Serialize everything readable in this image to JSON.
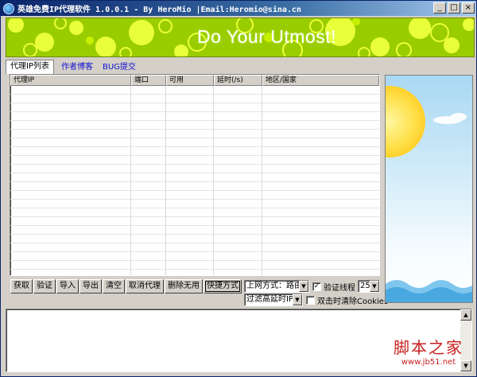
{
  "window": {
    "title": "英雄免费IP代理软件 1.0.0.1 - By HeroMio |Email:Heromio@sina.cn",
    "minimize": "_",
    "maximize": "□",
    "close": "×"
  },
  "banner": {
    "text": "Do Your Utmost!",
    "background_color": "#9acd00",
    "bubble_color": "#e9ff3a"
  },
  "tabs": [
    {
      "label": "代理IP列表",
      "active": true
    },
    {
      "label": "作者博客",
      "active": false
    },
    {
      "label": "BUG提交",
      "active": false
    }
  ],
  "proxy_table": {
    "columns": [
      "代理IP",
      "端口",
      "可用",
      "延时(/s)",
      "地区/国家"
    ],
    "rows": []
  },
  "buttons": {
    "fetch": "获取",
    "verify": "验证",
    "import": "导入",
    "export": "导出",
    "clear": "清空",
    "cancel_proxy": "取消代理",
    "delete_useless": "删除无用",
    "shortcut": "快捷方式"
  },
  "options": {
    "net_mode": "上网方式：路由",
    "filter": "过滤高延时IP",
    "verify_threads_label": "验证线程",
    "verify_threads_checked": true,
    "threads_value": "25",
    "dblclick_clear_label": "双击时清除Cookies",
    "dblclick_clear_checked": false
  },
  "watermark": {
    "main": "脚本之家",
    "url": "www.jb51.net"
  }
}
